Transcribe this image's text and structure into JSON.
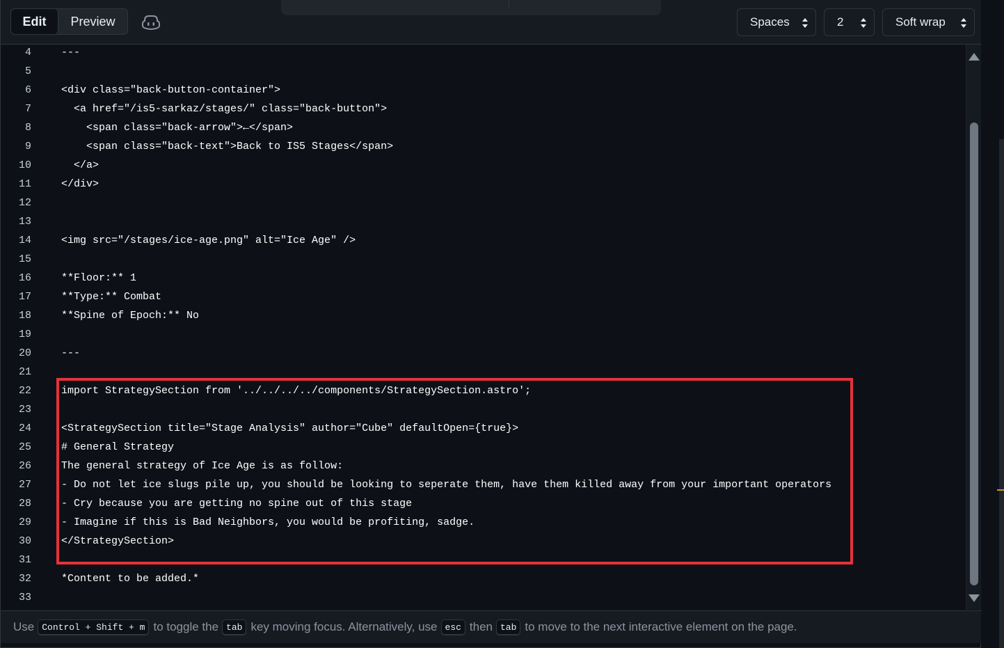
{
  "toolbar": {
    "tabs": [
      {
        "label": "Edit",
        "active": true
      },
      {
        "label": "Preview",
        "active": false
      }
    ],
    "indent_mode": "Spaces",
    "indent_size": "2",
    "wrap_mode": "Soft wrap"
  },
  "editor": {
    "lines": [
      {
        "n": "4",
        "text": "---"
      },
      {
        "n": "5",
        "text": ""
      },
      {
        "n": "6",
        "text": "<div class=\"back-button-container\">"
      },
      {
        "n": "7",
        "text": "  <a href=\"/is5-sarkaz/stages/\" class=\"back-button\">"
      },
      {
        "n": "8",
        "text": "    <span class=\"back-arrow\">←</span>"
      },
      {
        "n": "9",
        "text": "    <span class=\"back-text\">Back to IS5 Stages</span>"
      },
      {
        "n": "10",
        "text": "  </a>"
      },
      {
        "n": "11",
        "text": "</div>"
      },
      {
        "n": "12",
        "text": ""
      },
      {
        "n": "13",
        "text": ""
      },
      {
        "n": "14",
        "text": "<img src=\"/stages/ice-age.png\" alt=\"Ice Age\" />"
      },
      {
        "n": "15",
        "text": ""
      },
      {
        "n": "16",
        "text": "**Floor:** 1"
      },
      {
        "n": "17",
        "text": "**Type:** Combat"
      },
      {
        "n": "18",
        "text": "**Spine of Epoch:** No"
      },
      {
        "n": "19",
        "text": ""
      },
      {
        "n": "20",
        "text": "---"
      },
      {
        "n": "21",
        "text": ""
      },
      {
        "n": "22",
        "text": "import StrategySection from '../../../../components/StrategySection.astro';"
      },
      {
        "n": "23",
        "text": ""
      },
      {
        "n": "24",
        "text": "<StrategySection title=\"Stage Analysis\" author=\"Cube\" defaultOpen={true}>"
      },
      {
        "n": "25",
        "text": "# General Strategy"
      },
      {
        "n": "26",
        "text": "The general strategy of Ice Age is as follow:"
      },
      {
        "n": "27",
        "text": "- Do not let ice slugs pile up, you should be looking to seperate them, have them killed away from your important operators"
      },
      {
        "n": "28",
        "text": "- Cry because you are getting no spine out of this stage"
      },
      {
        "n": "29",
        "text": "- Imagine if this is Bad Neighbors, you would be profiting, sadge."
      },
      {
        "n": "30",
        "text": "</StrategySection>"
      },
      {
        "n": "31",
        "text": ""
      },
      {
        "n": "32",
        "text": "*Content to be added.*"
      },
      {
        "n": "33",
        "text": ""
      }
    ]
  },
  "footer": {
    "t1": "Use",
    "k1": "Control + Shift + m",
    "t2": "to toggle the",
    "k2": "tab",
    "t3": "key moving focus. Alternatively, use",
    "k3": "esc",
    "t4": "then",
    "k4": "tab",
    "t5": "to move to the next interactive element on the page."
  },
  "colors": {
    "highlight_border": "#e5323b",
    "background": "#0d1117"
  }
}
